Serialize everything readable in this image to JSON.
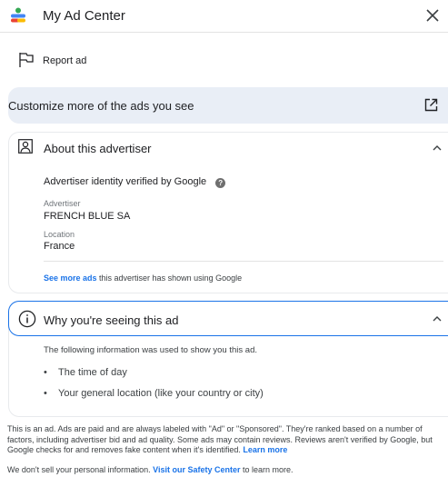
{
  "header": {
    "title": "My Ad Center",
    "logo_icon": "my-ad-center-logo",
    "close_icon": "close-icon"
  },
  "report": {
    "label": "Report ad",
    "icon": "flag-icon"
  },
  "customize": {
    "label": "Customize more of the ads you see",
    "icon": "open-in-new-icon"
  },
  "advertiser_card": {
    "title": "About this advertiser",
    "verified_text": "Advertiser identity verified by Google",
    "advertiser_label": "Advertiser",
    "advertiser_value": "FRENCH BLUE SA",
    "location_label": "Location",
    "location_value": "France",
    "see_more_link": "See more ads",
    "see_more_rest": " this advertiser has shown using Google"
  },
  "why_card": {
    "title": "Why you're seeing this ad",
    "intro": "The following information was used to show you this ad.",
    "reasons": [
      "The time of day",
      "Your general location (like your country or city)"
    ]
  },
  "footer": {
    "disclaimer": "This is an ad. Ads are paid and are always labeled with \"Ad\" or \"Sponsored\". They're ranked based on a number of factors, including advertiser bid and ad quality. Some ads may contain reviews. Reviews aren't verified by Google, but Google checks for and removes fake content when it's identified. ",
    "learn_more": "Learn more",
    "privacy_prefix": "We don't sell your personal information. ",
    "safety_link": "Visit our Safety Center",
    "privacy_suffix": " to learn more."
  },
  "colors": {
    "accent": "#1a73e8",
    "customize_bg": "#e9eef6"
  }
}
